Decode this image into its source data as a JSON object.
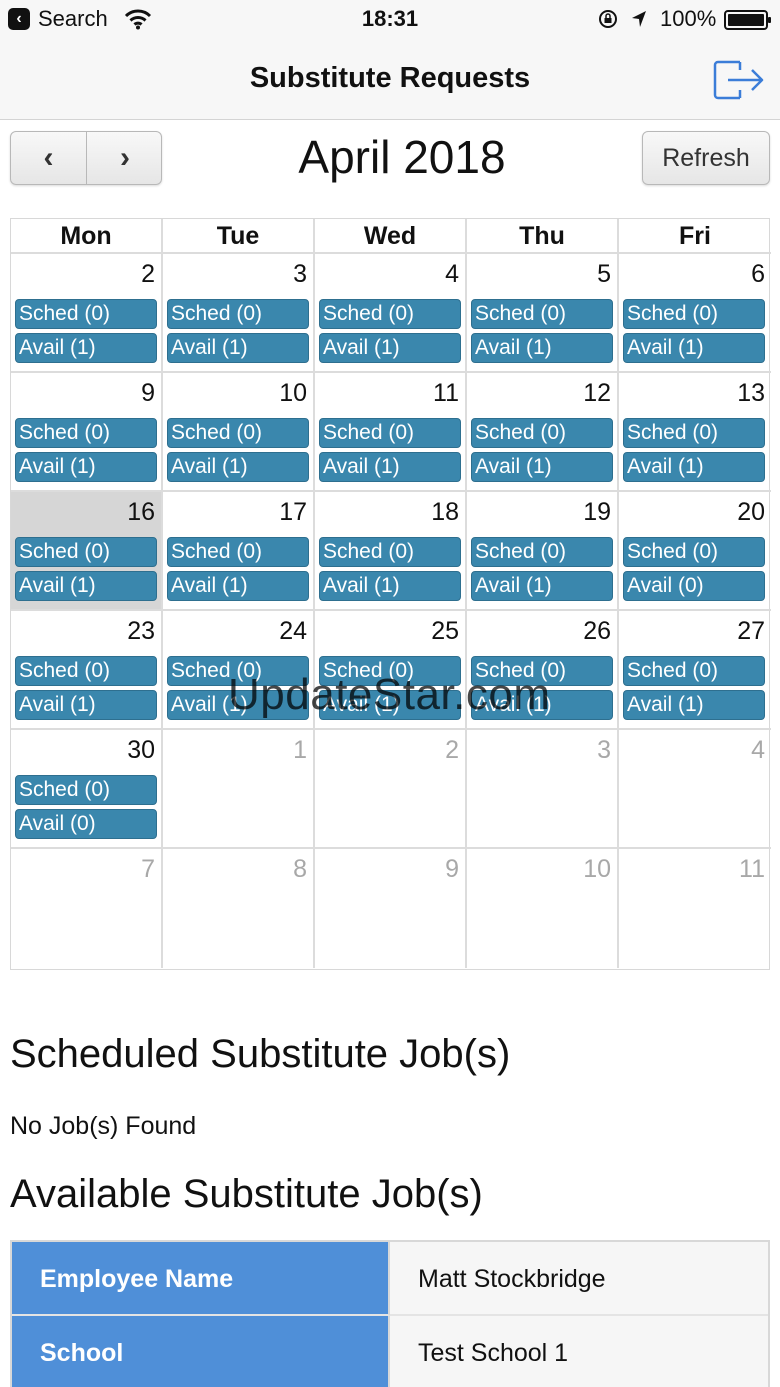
{
  "status_bar": {
    "back_label": "Search",
    "time": "18:31",
    "battery": "100%"
  },
  "nav": {
    "title": "Substitute Requests",
    "logout_icon": "logout-arrow-icon"
  },
  "calendar": {
    "title": "April 2018",
    "prev_label": "‹",
    "next_label": "›",
    "refresh_label": "Refresh",
    "weekdays": [
      "Mon",
      "Tue",
      "Wed",
      "Thu",
      "Fri"
    ],
    "weeks": [
      [
        {
          "day": "2",
          "sched": "Sched (0)",
          "avail": "Avail (1)"
        },
        {
          "day": "3",
          "sched": "Sched (0)",
          "avail": "Avail (1)"
        },
        {
          "day": "4",
          "sched": "Sched (0)",
          "avail": "Avail (1)"
        },
        {
          "day": "5",
          "sched": "Sched (0)",
          "avail": "Avail (1)"
        },
        {
          "day": "6",
          "sched": "Sched (0)",
          "avail": "Avail (1)"
        }
      ],
      [
        {
          "day": "9",
          "sched": "Sched (0)",
          "avail": "Avail (1)"
        },
        {
          "day": "10",
          "sched": "Sched (0)",
          "avail": "Avail (1)"
        },
        {
          "day": "11",
          "sched": "Sched (0)",
          "avail": "Avail (1)"
        },
        {
          "day": "12",
          "sched": "Sched (0)",
          "avail": "Avail (1)"
        },
        {
          "day": "13",
          "sched": "Sched (0)",
          "avail": "Avail (1)"
        }
      ],
      [
        {
          "day": "16",
          "sched": "Sched (0)",
          "avail": "Avail (1)",
          "today": true
        },
        {
          "day": "17",
          "sched": "Sched (0)",
          "avail": "Avail (1)"
        },
        {
          "day": "18",
          "sched": "Sched (0)",
          "avail": "Avail (1)"
        },
        {
          "day": "19",
          "sched": "Sched (0)",
          "avail": "Avail (1)"
        },
        {
          "day": "20",
          "sched": "Sched (0)",
          "avail": "Avail (0)"
        }
      ],
      [
        {
          "day": "23",
          "sched": "Sched (0)",
          "avail": "Avail (1)"
        },
        {
          "day": "24",
          "sched": "Sched (0)",
          "avail": "Avail (1)"
        },
        {
          "day": "25",
          "sched": "Sched (0)",
          "avail": "Avail (1)"
        },
        {
          "day": "26",
          "sched": "Sched (0)",
          "avail": "Avail (1)"
        },
        {
          "day": "27",
          "sched": "Sched (0)",
          "avail": "Avail (1)"
        }
      ],
      [
        {
          "day": "30",
          "sched": "Sched (0)",
          "avail": "Avail (0)"
        },
        {
          "day": "1",
          "other": true
        },
        {
          "day": "2",
          "other": true
        },
        {
          "day": "3",
          "other": true
        },
        {
          "day": "4",
          "other": true
        }
      ],
      [
        {
          "day": "7",
          "other": true
        },
        {
          "day": "8",
          "other": true
        },
        {
          "day": "9",
          "other": true
        },
        {
          "day": "10",
          "other": true
        },
        {
          "day": "11",
          "other": true
        }
      ]
    ]
  },
  "watermark": "UpdateStar.com",
  "scheduled": {
    "heading": "Scheduled Substitute Job(s)",
    "empty_text": "No Job(s) Found"
  },
  "available": {
    "heading": "Available Substitute Job(s)",
    "rows": [
      {
        "label": "Employee Name",
        "value": "Matt Stockbridge"
      },
      {
        "label": "School",
        "value": "Test School 1"
      }
    ]
  },
  "colors": {
    "event": "#3a87ad",
    "table_header": "#4f8fd8",
    "today": "#d6d6d6",
    "accent": "#3b7dd8"
  }
}
